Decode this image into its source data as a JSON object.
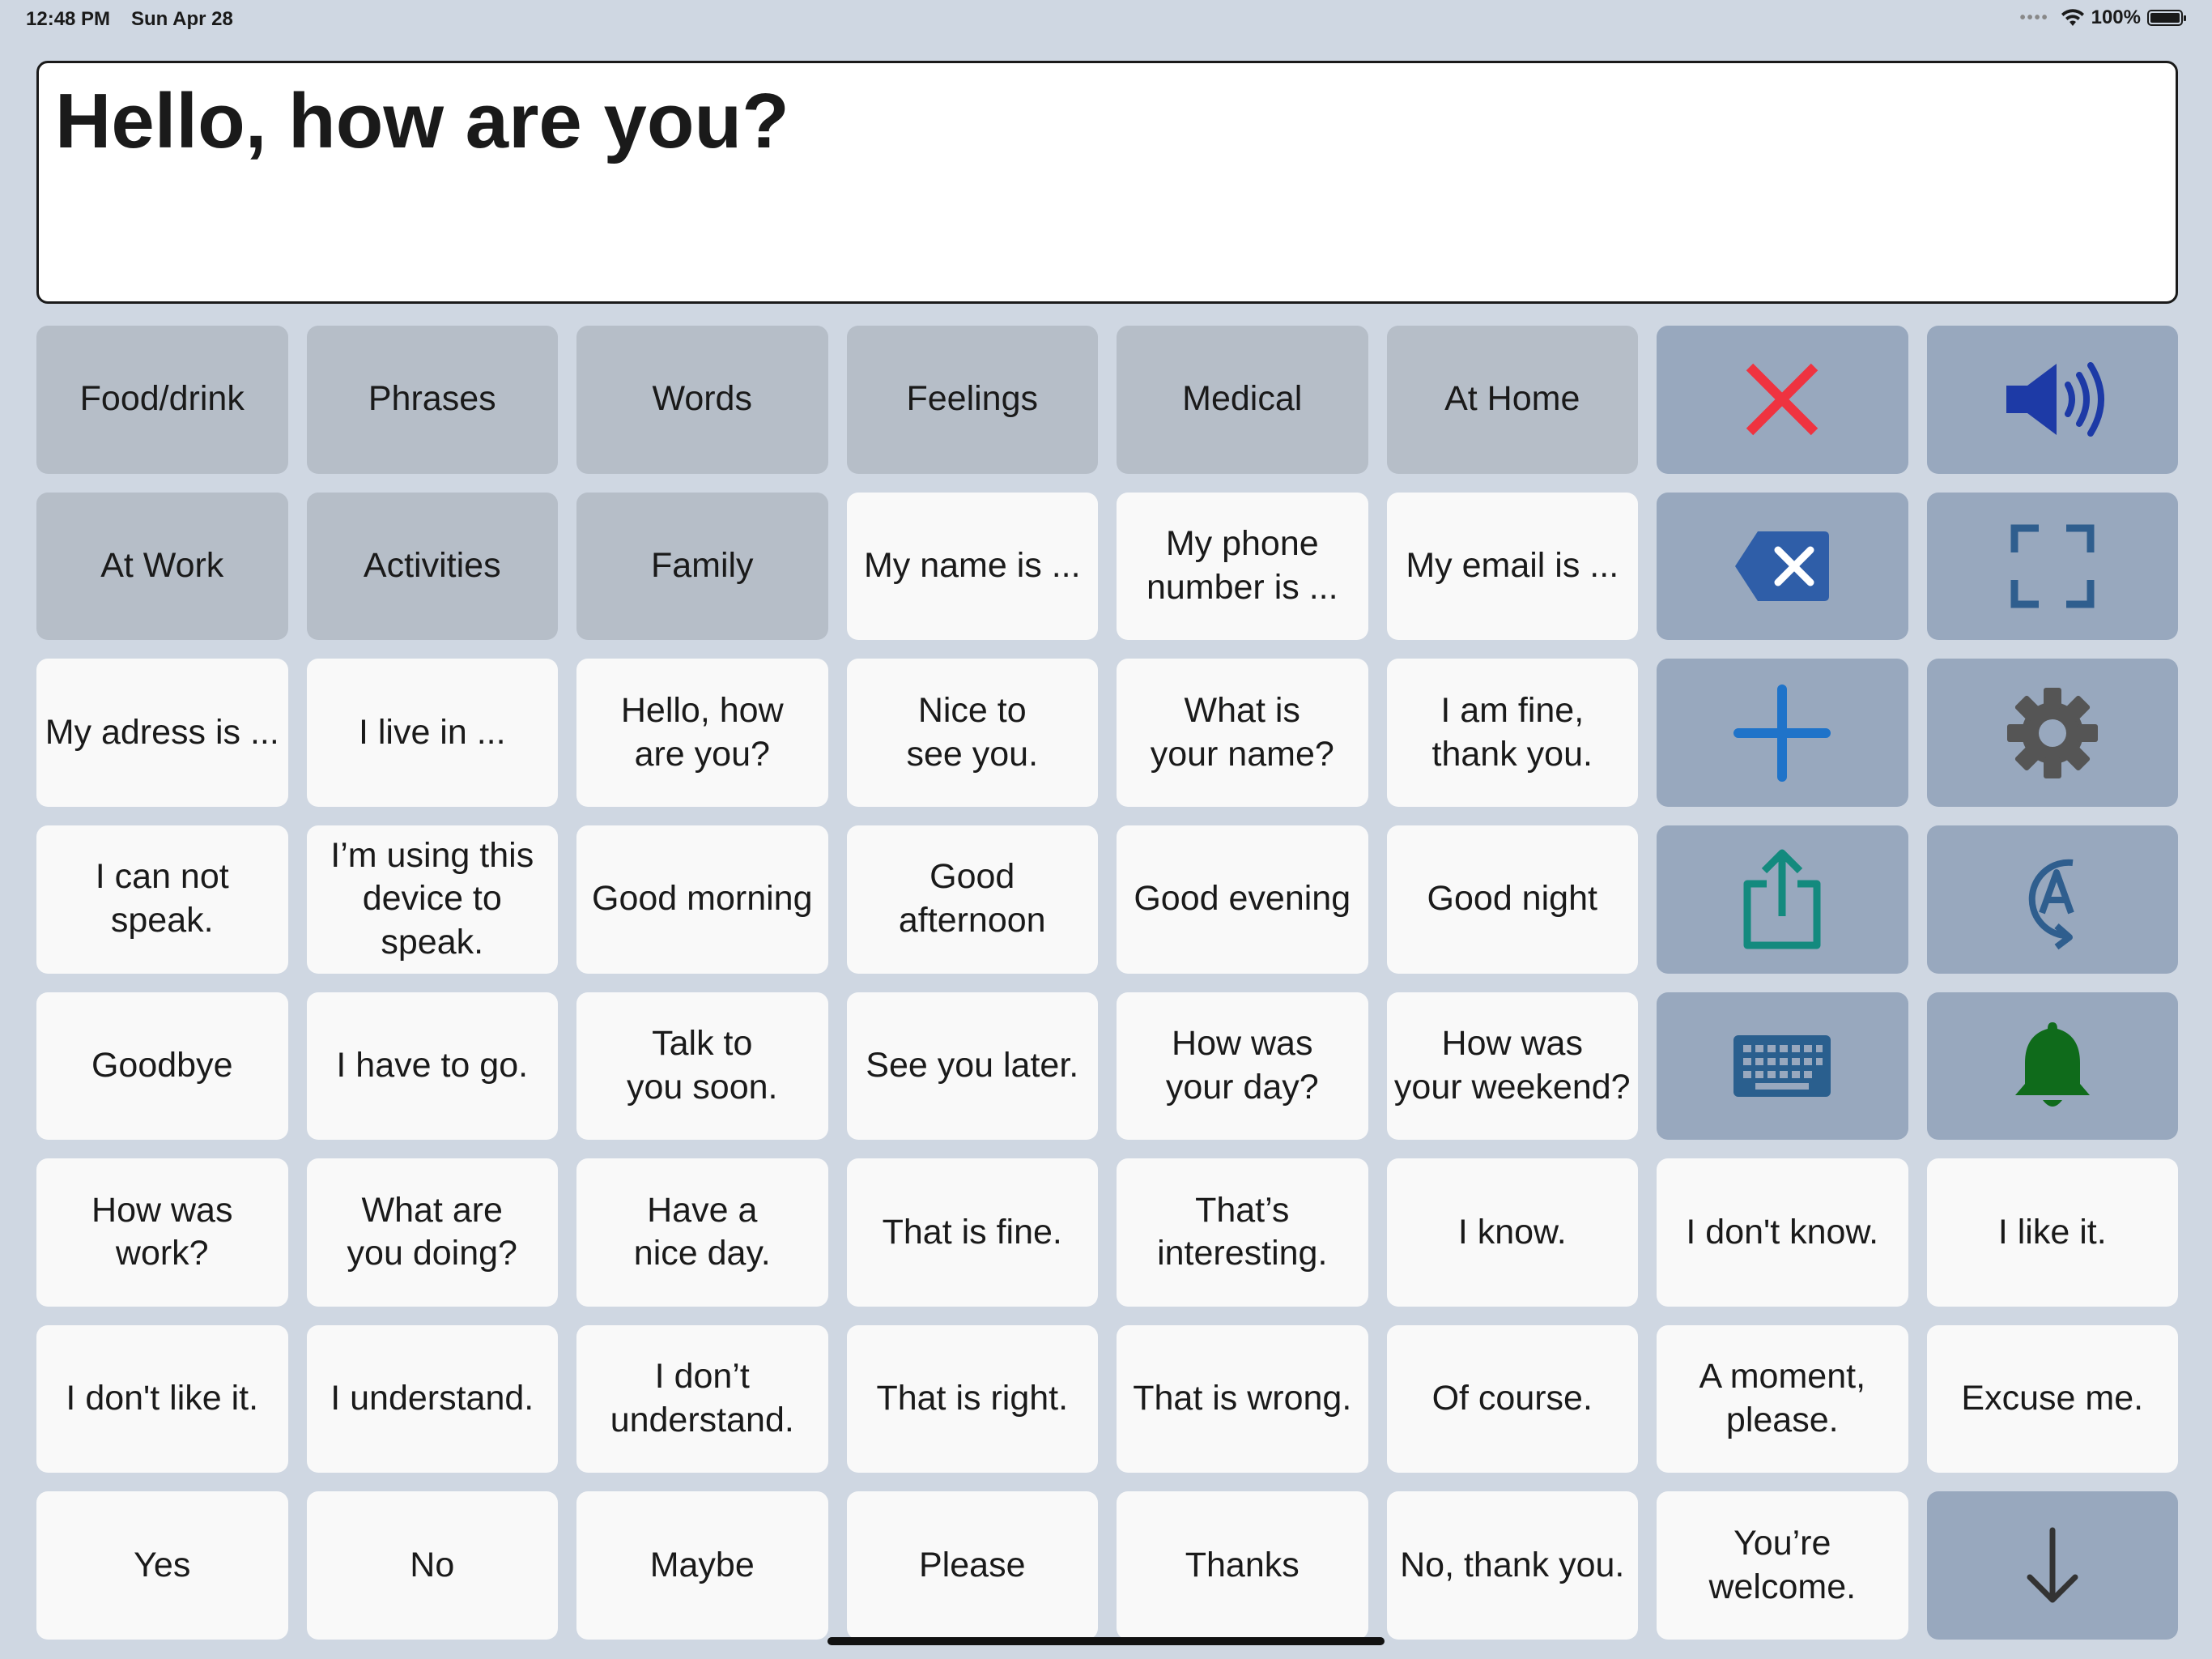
{
  "status_bar": {
    "time": "12:48 PM",
    "date": "Sun Apr 28",
    "battery": "100%"
  },
  "text_display": {
    "text": "Hello, how are you?"
  },
  "categories": [
    "Food/drink",
    "Phrases",
    "Words",
    "Feelings",
    "Medical",
    "At Home",
    "At Work",
    "Activities",
    "Family"
  ],
  "phrases": [
    "My name is ...",
    "My phone\nnumber is ...",
    "My email is ...",
    "My adress is ...",
    "I live in ...",
    "Hello, how\nare you?",
    "Nice to\nsee you.",
    "What is\nyour name?",
    "I am fine,\nthank you.",
    "I can not\nspeak.",
    "I’m using this\ndevice to\nspeak.",
    "Good morning",
    "Good\nafternoon",
    "Good evening",
    "Good night",
    "Goodbye",
    "I have to go.",
    "Talk to\nyou soon.",
    "See you later.",
    "How was\nyour day?",
    "How was\nyour weekend?",
    "How was\nwork?",
    "What are\nyou doing?",
    "Have a\nnice day.",
    "That is fine.",
    "That’s\ninteresting.",
    "I know.",
    "I don't know.",
    "I like it.",
    "I don't like it.",
    "I understand.",
    "I don’t\nunderstand.",
    "That is right.",
    "That is wrong.",
    "Of course.",
    "A moment,\nplease.",
    "Excuse me.",
    "Yes",
    "No",
    "Maybe",
    "Please",
    "Thanks",
    "No, thank you.",
    "You’re\nwelcome."
  ],
  "actions": {
    "clear": {
      "icon": "close-icon",
      "color": "#ef3340"
    },
    "speak": {
      "icon": "speaker-icon",
      "color": "#1d3aa6"
    },
    "backspace": {
      "icon": "backspace-icon",
      "color": "#2f5ea8"
    },
    "fullscreen": {
      "icon": "fullscreen-icon",
      "color": "#2f5e8e"
    },
    "add": {
      "icon": "plus-icon",
      "color": "#1f73c9"
    },
    "settings": {
      "icon": "gear-icon",
      "color": "#555555"
    },
    "share": {
      "icon": "share-icon",
      "color": "#138a7e"
    },
    "text_direction": {
      "icon": "rotate-text-icon",
      "color": "#2f5e8e"
    },
    "keyboard": {
      "icon": "keyboard-icon",
      "color": "#2a5f8e"
    },
    "alarm": {
      "icon": "bell-icon",
      "color": "#0f6b1b"
    },
    "scroll_down": {
      "icon": "arrow-down-icon",
      "color": "#333333"
    }
  }
}
